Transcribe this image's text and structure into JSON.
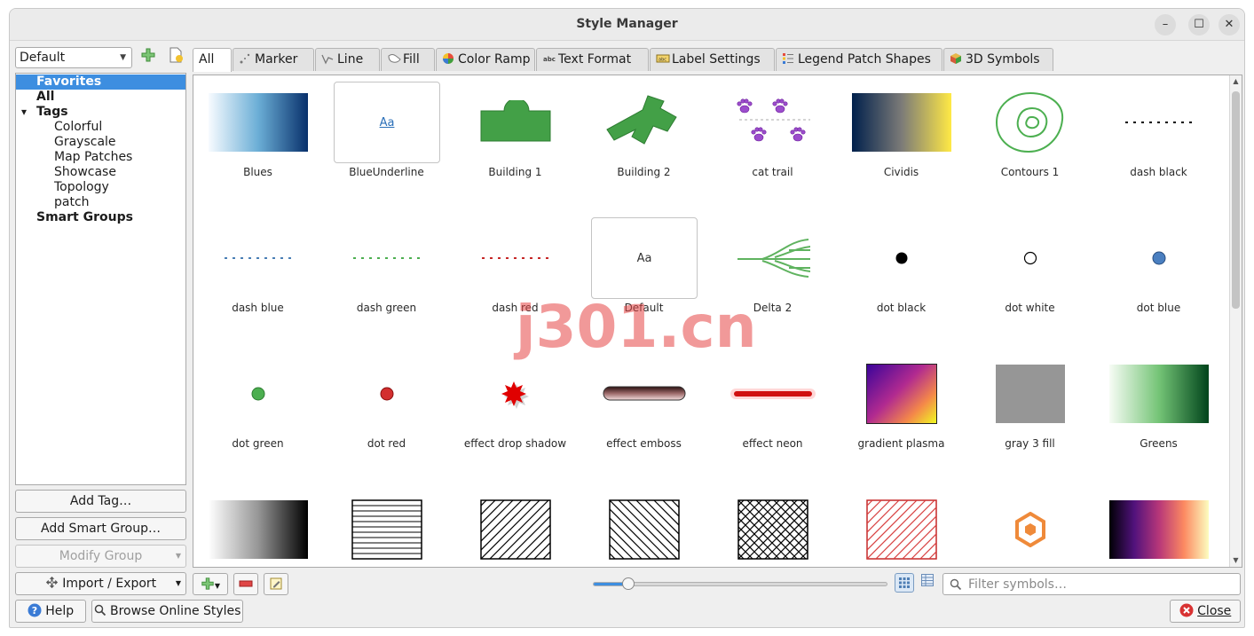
{
  "window": {
    "title": "Style Manager",
    "controls": {
      "minimize": "–",
      "maximize": "☐",
      "close": "✕"
    }
  },
  "sidebar": {
    "style_combo": "Default",
    "tree": [
      {
        "label": "Favorites",
        "level": 0,
        "bold": true,
        "selected": true
      },
      {
        "label": "All",
        "level": 0,
        "bold": true,
        "selected": false
      },
      {
        "label": "Tags",
        "level": 0,
        "bold": true,
        "selected": false,
        "expanded": true
      },
      {
        "label": "Colorful",
        "level": 1,
        "bold": false,
        "selected": false
      },
      {
        "label": "Grayscale",
        "level": 1,
        "bold": false,
        "selected": false
      },
      {
        "label": "Map Patches",
        "level": 1,
        "bold": false,
        "selected": false
      },
      {
        "label": "Showcase",
        "level": 1,
        "bold": false,
        "selected": false
      },
      {
        "label": "Topology",
        "level": 1,
        "bold": false,
        "selected": false
      },
      {
        "label": "patch",
        "level": 1,
        "bold": false,
        "selected": false
      },
      {
        "label": "Smart Groups",
        "level": 0,
        "bold": true,
        "selected": false
      }
    ],
    "add_tag": "Add Tag…",
    "add_smart_group": "Add Smart Group…",
    "modify_group": "Modify Group",
    "import_export": "Import / Export"
  },
  "tabs": [
    {
      "label": "All",
      "icon": "",
      "active": true
    },
    {
      "label": "Marker",
      "icon": "marker-icon",
      "active": false
    },
    {
      "label": "Line",
      "icon": "line-icon",
      "active": false
    },
    {
      "label": "Fill",
      "icon": "fill-icon",
      "active": false
    },
    {
      "label": "Color Ramp",
      "icon": "color-ramp-icon",
      "active": false
    },
    {
      "label": "Text Format",
      "icon": "text-format-icon",
      "active": false
    },
    {
      "label": "Label Settings",
      "icon": "label-settings-icon",
      "active": false
    },
    {
      "label": "Legend Patch Shapes",
      "icon": "legend-patch-icon",
      "active": false
    },
    {
      "label": "3D Symbols",
      "icon": "cube-icon",
      "active": false
    }
  ],
  "symbols": [
    {
      "name": "Blues",
      "kind": "ramp-blues"
    },
    {
      "name": "BlueUnderline",
      "kind": "text-blue"
    },
    {
      "name": "Building 1",
      "kind": "building1"
    },
    {
      "name": "Building 2",
      "kind": "building2"
    },
    {
      "name": "cat trail",
      "kind": "cattrail"
    },
    {
      "name": "Cividis",
      "kind": "ramp-cividis"
    },
    {
      "name": "Contours 1",
      "kind": "contours"
    },
    {
      "name": "dash  black",
      "kind": "dash-black"
    },
    {
      "name": "dash blue",
      "kind": "dash-blue"
    },
    {
      "name": "dash green",
      "kind": "dash-green"
    },
    {
      "name": "dash red",
      "kind": "dash-red"
    },
    {
      "name": "Default",
      "kind": "text-default"
    },
    {
      "name": "Delta 2",
      "kind": "delta"
    },
    {
      "name": "dot  black",
      "kind": "dot-black"
    },
    {
      "name": "dot  white",
      "kind": "dot-white"
    },
    {
      "name": "dot blue",
      "kind": "dot-blue"
    },
    {
      "name": "dot green",
      "kind": "dot-green"
    },
    {
      "name": "dot red",
      "kind": "dot-red"
    },
    {
      "name": "effect drop shadow",
      "kind": "star-shadow"
    },
    {
      "name": "effect emboss",
      "kind": "emboss"
    },
    {
      "name": "effect neon",
      "kind": "neon"
    },
    {
      "name": "gradient  plasma",
      "kind": "plasma-fill"
    },
    {
      "name": "gray 3 fill",
      "kind": "gray-fill"
    },
    {
      "name": "Greens",
      "kind": "ramp-greens"
    },
    {
      "name": "",
      "kind": "ramp-greys"
    },
    {
      "name": "",
      "kind": "hatch-horizontal"
    },
    {
      "name": "",
      "kind": "hatch-diagonal"
    },
    {
      "name": "",
      "kind": "hatch-diagonal-rev"
    },
    {
      "name": "",
      "kind": "hatch-cross"
    },
    {
      "name": "",
      "kind": "hatch-red"
    },
    {
      "name": "",
      "kind": "hexagon"
    },
    {
      "name": "",
      "kind": "ramp-magma"
    }
  ],
  "text_preview": {
    "sample": "Aa"
  },
  "bottom": {
    "search_placeholder": "Filter symbols…",
    "icon_size_level": 0.12,
    "help": "Help",
    "browse_online": "Browse Online Styles",
    "close": "Close"
  },
  "watermark": "j301.cn",
  "colors": {
    "selection": "#3d8ee0",
    "building_green": "#3f9e3f"
  }
}
